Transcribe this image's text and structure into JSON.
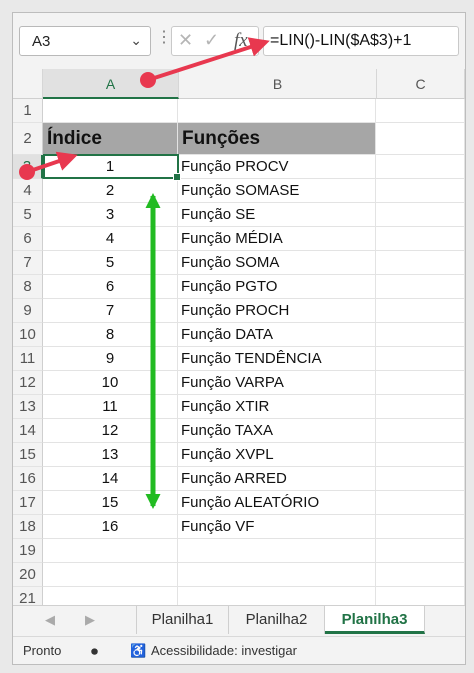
{
  "name_box": {
    "value": "A3"
  },
  "formula_bar": {
    "formula": "=LIN()-LIN($A$3)+1"
  },
  "columns": [
    "A",
    "B",
    "C"
  ],
  "row_numbers": [
    "1",
    "2",
    "3",
    "4",
    "5",
    "6",
    "7",
    "8",
    "9",
    "10",
    "11",
    "12",
    "13",
    "14",
    "15",
    "16",
    "17",
    "18",
    "19",
    "20",
    "21"
  ],
  "headers": {
    "index": "Índice",
    "functions": "Funções"
  },
  "table": [
    {
      "index": "1",
      "func": "Função PROCV"
    },
    {
      "index": "2",
      "func": "Função SOMASE"
    },
    {
      "index": "3",
      "func": "Função SE"
    },
    {
      "index": "4",
      "func": "Função MÉDIA"
    },
    {
      "index": "5",
      "func": "Função SOMA"
    },
    {
      "index": "6",
      "func": "Função PGTO"
    },
    {
      "index": "7",
      "func": "Função PROCH"
    },
    {
      "index": "8",
      "func": "Função DATA"
    },
    {
      "index": "9",
      "func": "Função TENDÊNCIA"
    },
    {
      "index": "10",
      "func": "Função VARPA"
    },
    {
      "index": "11",
      "func": "Função XTIR"
    },
    {
      "index": "12",
      "func": "Função TAXA"
    },
    {
      "index": "13",
      "func": "Função XVPL"
    },
    {
      "index": "14",
      "func": "Função ARRED"
    },
    {
      "index": "15",
      "func": "Função ALEATÓRIO"
    },
    {
      "index": "16",
      "func": "Função VF"
    }
  ],
  "sheets": [
    {
      "label": "Planilha1",
      "active": false
    },
    {
      "label": "Planilha2",
      "active": false
    },
    {
      "label": "Planilha3",
      "active": true
    }
  ],
  "status": {
    "ready": "Pronto",
    "accessibility": "Acessibilidade: investigar"
  },
  "colors": {
    "accent": "#217346",
    "header_fill": "#a6a6a6",
    "annotation_red": "#e8384f",
    "annotation_green": "#22bb22"
  },
  "icons": {
    "name_box_dropdown": "chevron-down-icon",
    "cancel": "cancel-x-icon",
    "enter": "checkmark-icon",
    "function": "fx-icon"
  }
}
